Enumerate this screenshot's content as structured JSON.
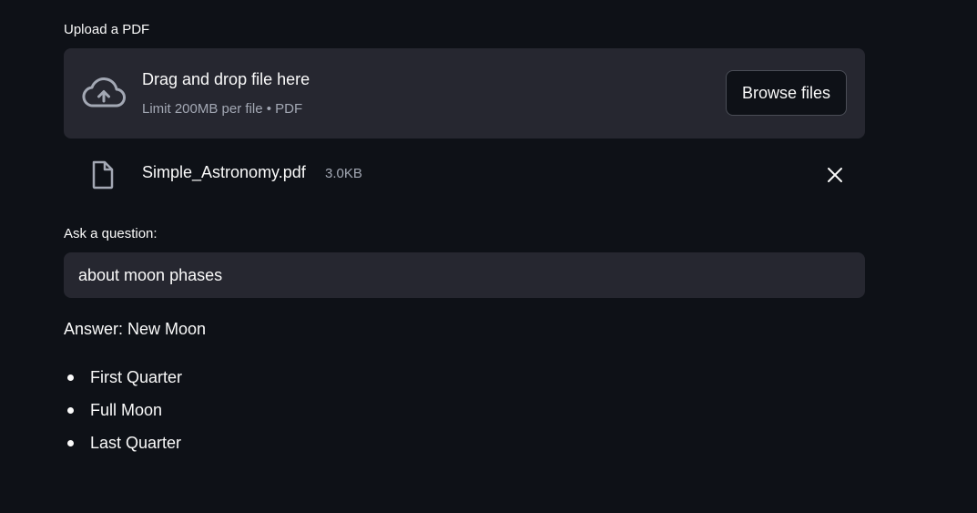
{
  "uploader": {
    "label": "Upload a PDF",
    "drop_text": "Drag and drop file here",
    "limit_text": "Limit 200MB per file • PDF",
    "browse_label": "Browse files",
    "icon": "cloud-upload-icon"
  },
  "uploaded_file": {
    "name": "Simple_Astronomy.pdf",
    "size": "3.0KB",
    "icon": "file-icon",
    "remove_icon": "close-icon"
  },
  "question": {
    "label": "Ask a question:",
    "value": "about moon phases"
  },
  "answer": {
    "text": "Answer: New Moon",
    "items": [
      "First Quarter",
      "Full Moon",
      "Last Quarter"
    ]
  },
  "colors": {
    "background": "#0e1117",
    "panel": "#262730",
    "text": "#fafafa",
    "muted": "#a3a8b4"
  }
}
